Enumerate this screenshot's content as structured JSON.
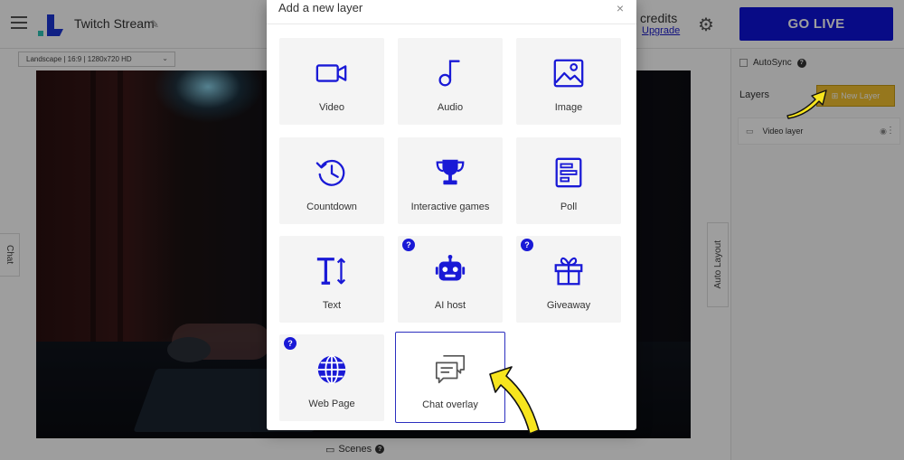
{
  "app": {
    "stream_title": "Twitch Stream",
    "credits_label": "credits",
    "upgrade_label": "Upgrade",
    "go_live_label": "GO LIVE",
    "resolution": "Landscape | 16:9 | 1280x720 HD"
  },
  "side_tabs": {
    "chat_label": "Chat",
    "auto_layout_label": "Auto Layout"
  },
  "bottom": {
    "scenes_label": "Scenes"
  },
  "right_panel": {
    "autosync_label": "AutoSync",
    "layers_label": "Layers",
    "new_layer_label": "New Layer",
    "layers": [
      {
        "name": "Video layer"
      }
    ]
  },
  "modal": {
    "title": "Add a new layer",
    "close_symbol": "×",
    "tiles": [
      {
        "label": "Video",
        "icon": "video-camera-icon"
      },
      {
        "label": "Audio",
        "icon": "music-note-icon"
      },
      {
        "label": "Image",
        "icon": "image-icon"
      },
      {
        "label": "Countdown",
        "icon": "countdown-clock-icon"
      },
      {
        "label": "Interactive games",
        "icon": "trophy-icon"
      },
      {
        "label": "Poll",
        "icon": "poll-icon"
      },
      {
        "label": "Text",
        "icon": "text-size-icon"
      },
      {
        "label": "AI host",
        "icon": "robot-icon",
        "help": "?"
      },
      {
        "label": "Giveaway",
        "icon": "gift-icon",
        "help": "?"
      },
      {
        "label": "Web Page",
        "icon": "globe-icon",
        "help": "?"
      },
      {
        "label": "Chat overlay",
        "icon": "chat-bubbles-icon",
        "selected": true
      }
    ]
  },
  "colors": {
    "accent_blue": "#1919d6",
    "go_live_bg": "#0e12d9",
    "new_layer_bg": "#f2c130",
    "annotation_arrow": "#f7e51e"
  }
}
